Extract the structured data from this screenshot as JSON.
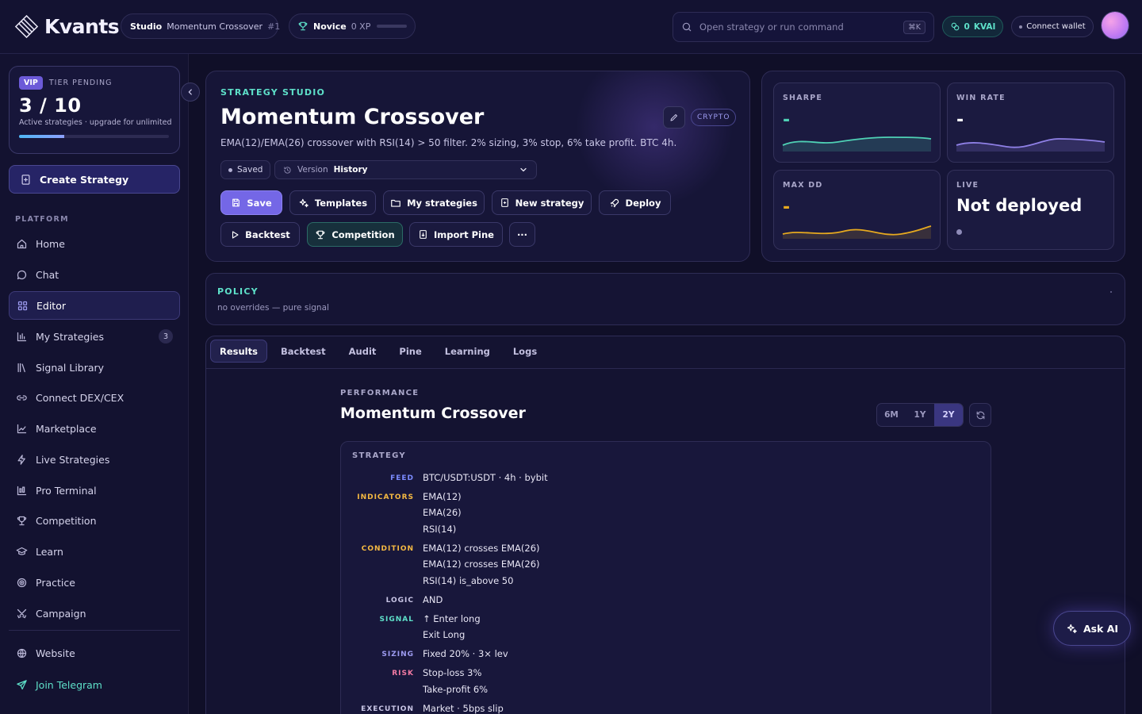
{
  "brand": {
    "name": "Kvants"
  },
  "topbar": {
    "studio_label": "Studio",
    "studio_strategy": "Momentum Crossover",
    "studio_number": "#1",
    "level_name": "Novice",
    "xp_text": "0 XP",
    "xp_progress": 0,
    "search_placeholder": "Open strategy or run command",
    "search_shortcut": "⌘K",
    "kvai_value": "0",
    "kvai_unit": "KVAI",
    "wallet_label": "Connect wallet"
  },
  "sidebar": {
    "vip_badge": "VIP",
    "tier_label": "TIER PENDING",
    "strategy_count": "3 / 10",
    "vip_sub": "Active strategies · upgrade for unlimited",
    "vip_progress": 0.3,
    "create_label": "Create Strategy",
    "section_label": "PLATFORM",
    "items": [
      {
        "label": "Home",
        "icon": "home-icon"
      },
      {
        "label": "Chat",
        "icon": "chat-icon"
      },
      {
        "label": "Editor",
        "icon": "grid-icon",
        "active": true
      },
      {
        "label": "My Strategies",
        "icon": "bar-chart-icon",
        "badge": "3"
      },
      {
        "label": "Signal Library",
        "icon": "library-icon"
      },
      {
        "label": "Connect DEX/CEX",
        "icon": "link-icon"
      },
      {
        "label": "Marketplace",
        "icon": "trend-icon"
      },
      {
        "label": "Live Strategies",
        "icon": "bolt-icon"
      },
      {
        "label": "Pro Terminal",
        "icon": "terminal-chart-icon"
      },
      {
        "label": "Competition",
        "icon": "trophy-icon"
      },
      {
        "label": "Learn",
        "icon": "graduation-cap-icon"
      },
      {
        "label": "Practice",
        "icon": "target-icon"
      },
      {
        "label": "Campaign",
        "icon": "swords-icon"
      }
    ],
    "footer_items": [
      {
        "label": "Website",
        "icon": "globe-icon"
      },
      {
        "label": "Join Telegram",
        "icon": "send-icon"
      }
    ]
  },
  "header": {
    "eyebrow": "STRATEGY STUDIO",
    "title": "Momentum Crossover",
    "description": "EMA(12)/EMA(26) crossover with RSI(14) > 50 filter. 2% sizing, 3% stop, 6% take profit. BTC 4h.",
    "category_badge": "CRYPTO",
    "saved_label": "Saved",
    "version_label": "Version",
    "version_value": "History",
    "buttons": {
      "save": "Save",
      "templates": "Templates",
      "my_strategies": "My strategies",
      "new_strategy": "New strategy",
      "deploy": "Deploy",
      "backtest": "Backtest",
      "competition": "Competition",
      "import_pine": "Import Pine",
      "more": "···"
    }
  },
  "metrics": {
    "sharpe": {
      "label": "SHARPE",
      "value": "-",
      "color": "#4fd1b5"
    },
    "win_rate": {
      "label": "WIN RATE",
      "value": "-",
      "color": "#8f80e6"
    },
    "max_dd": {
      "label": "MAX DD",
      "value": "-",
      "color": "#e6a91f"
    },
    "live": {
      "label": "LIVE",
      "value": "Not deployed"
    }
  },
  "policy": {
    "title": "POLICY",
    "subtitle": "no overrides — pure signal"
  },
  "tabs": [
    "Results",
    "Backtest",
    "Audit",
    "Pine",
    "Learning",
    "Logs"
  ],
  "performance": {
    "eyebrow": "PERFORMANCE",
    "title": "Momentum Crossover",
    "ranges": [
      "6M",
      "1Y",
      "2Y"
    ],
    "selected_range": "2Y"
  },
  "strategy_spec": {
    "title": "STRATEGY",
    "rows": [
      {
        "key": "FEED",
        "values": [
          "BTC/USDT:USDT · 4h · bybit"
        ]
      },
      {
        "key": "INDICATORS",
        "values": [
          "EMA(12)",
          "EMA(26)",
          "RSI(14)"
        ]
      },
      {
        "key": "CONDITION",
        "values": [
          "EMA(12) crosses EMA(26)",
          "EMA(12) crosses EMA(26)",
          "RSI(14) is_above 50"
        ]
      },
      {
        "key": "LOGIC",
        "values": [
          "AND"
        ]
      },
      {
        "key": "SIGNAL",
        "values": [
          "↑ Enter long",
          "Exit Long"
        ]
      },
      {
        "key": "SIZING",
        "values": [
          "Fixed 20% · 3× lev"
        ]
      },
      {
        "key": "RISK",
        "values": [
          "Stop-loss 3%",
          "Take-profit 6%"
        ]
      },
      {
        "key": "EXECUTION",
        "values": [
          "Market · 5bps slip"
        ]
      }
    ]
  },
  "ask_ai": {
    "label": "Ask AI"
  }
}
